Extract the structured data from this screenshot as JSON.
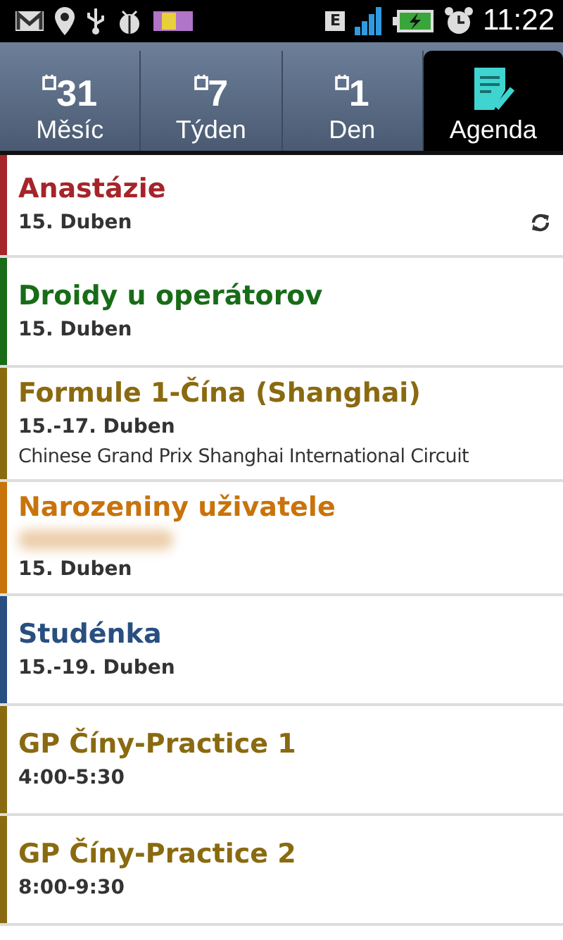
{
  "status_bar": {
    "network": "E",
    "time": "11:22"
  },
  "tabs": [
    {
      "number": "31",
      "label": "Měsíc",
      "kind": "calendar",
      "selected": false
    },
    {
      "number": "7",
      "label": "Týden",
      "kind": "calendar",
      "selected": false
    },
    {
      "number": "1",
      "label": "Den",
      "kind": "calendar",
      "selected": false
    },
    {
      "label": "Agenda",
      "kind": "agenda",
      "selected": true
    }
  ],
  "events": [
    {
      "title": "Anastázie",
      "date": "15. Duben",
      "color": "#a5252a",
      "repeating": true
    },
    {
      "title": "Droidy u operátorov",
      "date": "15. Duben",
      "color": "#186c18",
      "repeating": false
    },
    {
      "title": "Formule 1-Čína (Shanghai)",
      "date": "15.-17. Duben",
      "location": "Chinese Grand Prix Shanghai International Circuit",
      "color": "#8a6a10",
      "repeating": false
    },
    {
      "title": "Narozeniny uživatele",
      "date": "15. Duben",
      "color": "#c8730c",
      "repeating": false,
      "redacted": true
    },
    {
      "title": "Studénka",
      "date": "15.-19. Duben",
      "color": "#284f80",
      "repeating": false
    },
    {
      "title": "GP Číny-Practice 1",
      "date": "4:00-5:30",
      "color": "#8a6a10",
      "repeating": false
    },
    {
      "title": "GP Číny-Practice 2",
      "date": "8:00-9:30",
      "color": "#8a6a10",
      "repeating": false
    }
  ]
}
